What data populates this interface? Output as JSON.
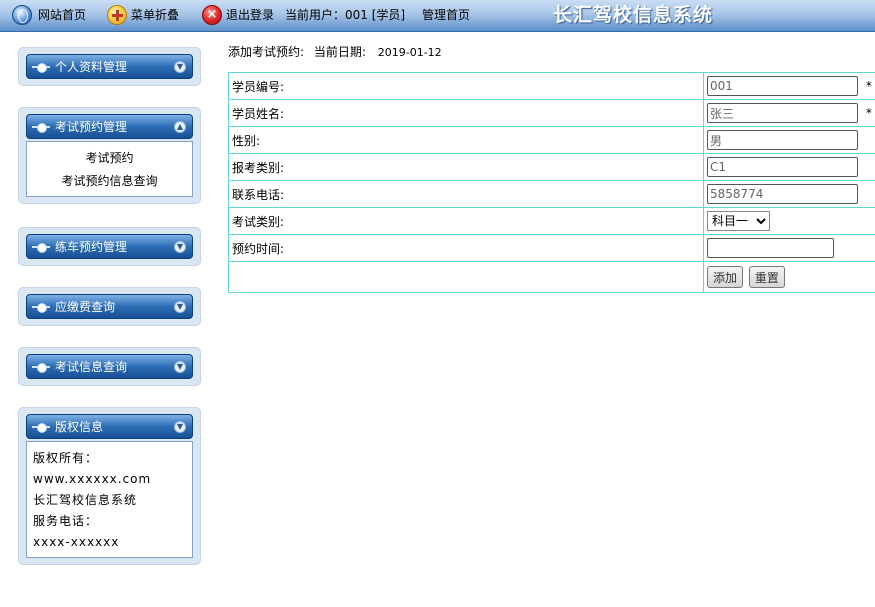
{
  "topbar": {
    "home_label": "网站首页",
    "collapse_label": "菜单折叠",
    "logout_label": "退出登录",
    "current_user": "当前用户：001 [学员]",
    "admin_home_label": "管理首页",
    "system_title": "长汇驾校信息系统"
  },
  "sidebar": {
    "panels": [
      {
        "title": "个人资料管理",
        "expanded": false
      },
      {
        "title": "考试预约管理",
        "expanded": true,
        "items": [
          "考试预约",
          "考试预约信息查询"
        ]
      },
      {
        "title": "练车预约管理",
        "expanded": false
      },
      {
        "title": "应缴费查询",
        "expanded": false
      },
      {
        "title": "考试信息查询",
        "expanded": false
      },
      {
        "title": "版权信息",
        "expanded": true,
        "lines": [
          "版权所有：",
          "www.xxxxxx.com",
          "长汇驾校信息系统",
          "服务电话：",
          "xxxx-xxxxxx"
        ]
      }
    ]
  },
  "main": {
    "heading": "添加考试预约:",
    "date_label": "当前日期:",
    "date_value": "2019-01-12",
    "form": {
      "student_id": {
        "label": "学员编号:",
        "value": "001",
        "required_mark": "*"
      },
      "student_name": {
        "label": "学员姓名:",
        "value": "张三",
        "required_mark": "*"
      },
      "gender": {
        "label": "性别:",
        "value": "男"
      },
      "license_type": {
        "label": "报考类别:",
        "value": "C1"
      },
      "phone": {
        "label": "联系电话:",
        "value": "5858774"
      },
      "exam_type": {
        "label": "考试类别:",
        "selected": "科目一"
      },
      "appointment_time": {
        "label": "预约时间:",
        "value": ""
      },
      "add_button": "添加",
      "reset_button": "重置"
    }
  },
  "colors": {
    "topbar_dark": "#5d8fc9",
    "panel_header": "#2d6db5",
    "table_border": "#5fd6da"
  }
}
